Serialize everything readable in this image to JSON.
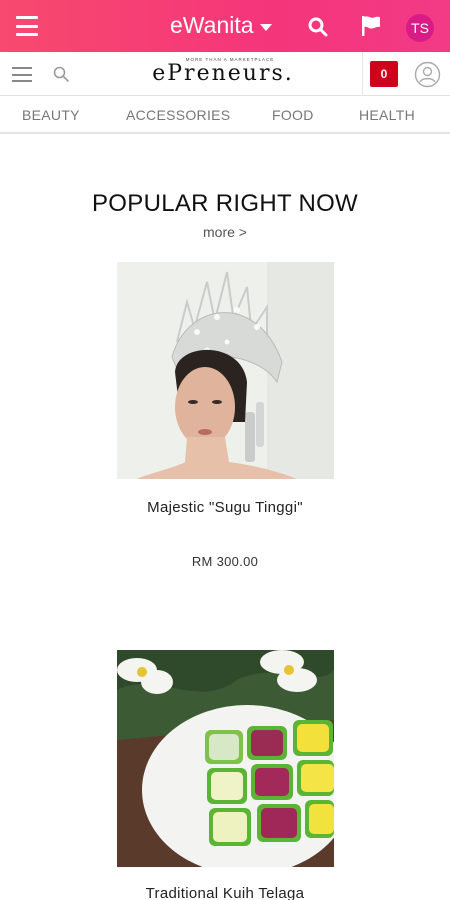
{
  "appbar": {
    "brand": "eWanita",
    "avatar_initials": "TS",
    "colors": {
      "bar": "#f5357a",
      "avatar": "#d81b86"
    }
  },
  "subheader": {
    "logo_text": "ePreneurs.",
    "logo_tagline": "MORE THAN A MARKETPLACE",
    "cart_count": "0",
    "cart_color": "#d0021b"
  },
  "categories": [
    "BEAUTY",
    "ACCESSORIES",
    "FOOD",
    "HEALTH"
  ],
  "section": {
    "title": "POPULAR RIGHT NOW",
    "more": "more >"
  },
  "products": [
    {
      "name": "Majestic \"Sugu Tinggi\"",
      "price": "RM 300.00",
      "image": "woman-wearing-silver-headdress"
    },
    {
      "name": "Traditional Kuih Telaga",
      "price": "",
      "image": "plate-of-green-yellow-purple-kuih"
    }
  ]
}
